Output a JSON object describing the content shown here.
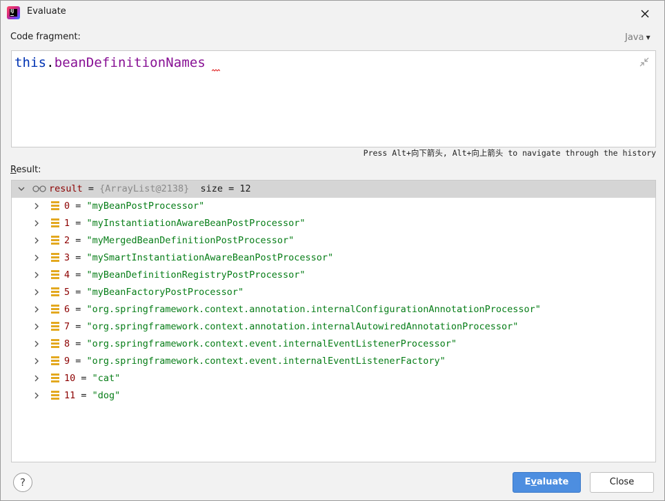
{
  "window": {
    "title": "Evaluate"
  },
  "code_fragment": {
    "label": "Code fragment:",
    "language": "Java",
    "code_keyword": "this",
    "code_dot": ".",
    "code_field": "beanDefinitionNames"
  },
  "history_hint": "Press Alt+向下箭头, Alt+向上箭头 to navigate through the history",
  "result": {
    "label_first": "R",
    "label_rest": "esult:",
    "root": {
      "name": "result",
      "eq": " = ",
      "ref": "{ArrayList@2138}",
      "size": "size = 12"
    },
    "items": [
      {
        "index": "0",
        "value": "\"myBeanPostProcessor\""
      },
      {
        "index": "1",
        "value": "\"myInstantiationAwareBeanPostProcessor\""
      },
      {
        "index": "2",
        "value": "\"myMergedBeanDefinitionPostProcessor\""
      },
      {
        "index": "3",
        "value": "\"mySmartInstantiationAwareBeanPostProcessor\""
      },
      {
        "index": "4",
        "value": "\"myBeanDefinitionRegistryPostProcessor\""
      },
      {
        "index": "5",
        "value": "\"myBeanFactoryPostProcessor\""
      },
      {
        "index": "6",
        "value": "\"org.springframework.context.annotation.internalConfigurationAnnotationProcessor\""
      },
      {
        "index": "7",
        "value": "\"org.springframework.context.annotation.internalAutowiredAnnotationProcessor\""
      },
      {
        "index": "8",
        "value": "\"org.springframework.context.event.internalEventListenerProcessor\""
      },
      {
        "index": "9",
        "value": "\"org.springframework.context.event.internalEventListenerFactory\""
      },
      {
        "index": "10",
        "value": "\"cat\""
      },
      {
        "index": "11",
        "value": "\"dog\""
      }
    ]
  },
  "buttons": {
    "help": "?",
    "evaluate_pre": "E",
    "evaluate_mnemonic": "v",
    "evaluate_post": "aluate",
    "close": "Close"
  },
  "icons": {
    "app": "intellij-idea-icon",
    "close": "close-icon",
    "collapse": "collapse-icon",
    "watch": "glasses-icon",
    "array_item": "array-element-icon",
    "expand": "chevron-right-icon",
    "collapse_tree": "chevron-down-icon"
  },
  "colors": {
    "keyword": "#0033b3",
    "field": "#871094",
    "string": "#067d17",
    "index": "#8c0000",
    "primary_button": "#4d8ee0"
  }
}
